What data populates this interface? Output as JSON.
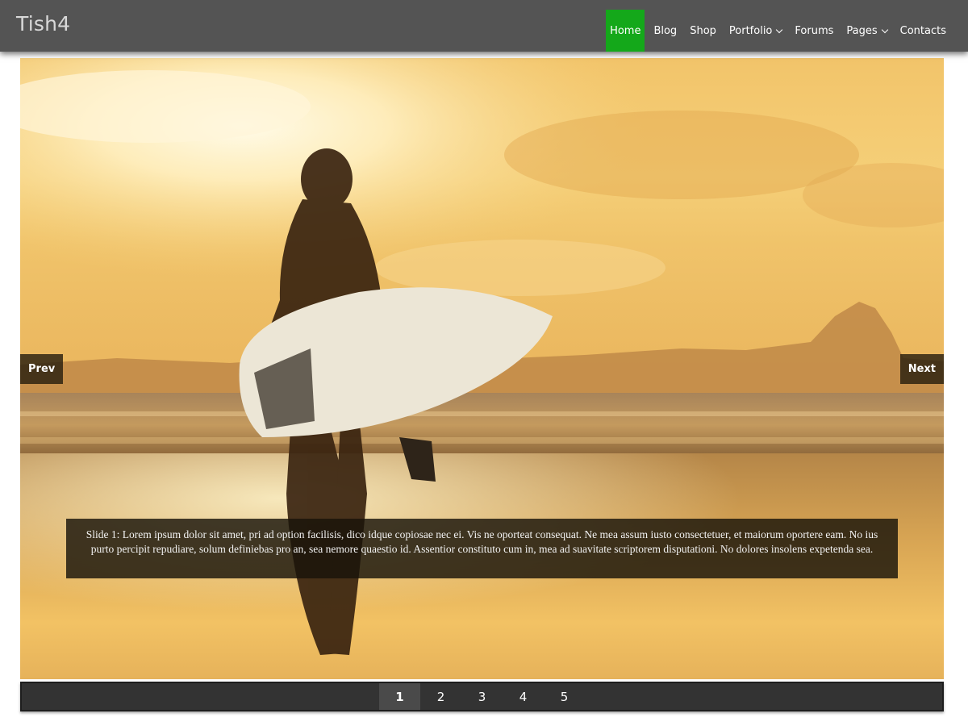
{
  "site": {
    "title": "Tish4"
  },
  "nav": {
    "items": [
      {
        "label": "Home",
        "active": true,
        "has_dropdown": false
      },
      {
        "label": "Blog",
        "active": false,
        "has_dropdown": false
      },
      {
        "label": "Shop",
        "active": false,
        "has_dropdown": false
      },
      {
        "label": "Portfolio",
        "active": false,
        "has_dropdown": true
      },
      {
        "label": "Forums",
        "active": false,
        "has_dropdown": false
      },
      {
        "label": "Pages",
        "active": false,
        "has_dropdown": true
      },
      {
        "label": "Contacts",
        "active": false,
        "has_dropdown": false
      }
    ],
    "active_color": "#14a81a"
  },
  "slider": {
    "prev_label": "Prev",
    "next_label": "Next",
    "caption": "Slide 1: Lorem ipsum dolor sit amet, pri ad option facilisis, dico idque copiosae nec ei. Vis ne oporteat consequat. Ne mea assum iusto consectetuer, et maiorum oportere eam. No ius purto percipit repudiare, solum definiebas pro an, sea nemore quaestio id. Assentior constituto cum in, mea ad suavitate scriptorem disputationi. No dolores insolens expetenda sea.",
    "image": "sunset-beach-surfer-photo"
  },
  "pager": {
    "pages": [
      "1",
      "2",
      "3",
      "4",
      "5"
    ],
    "current": "1"
  },
  "colors": {
    "header_bg": "#545454",
    "pager_bg": "#333333"
  }
}
